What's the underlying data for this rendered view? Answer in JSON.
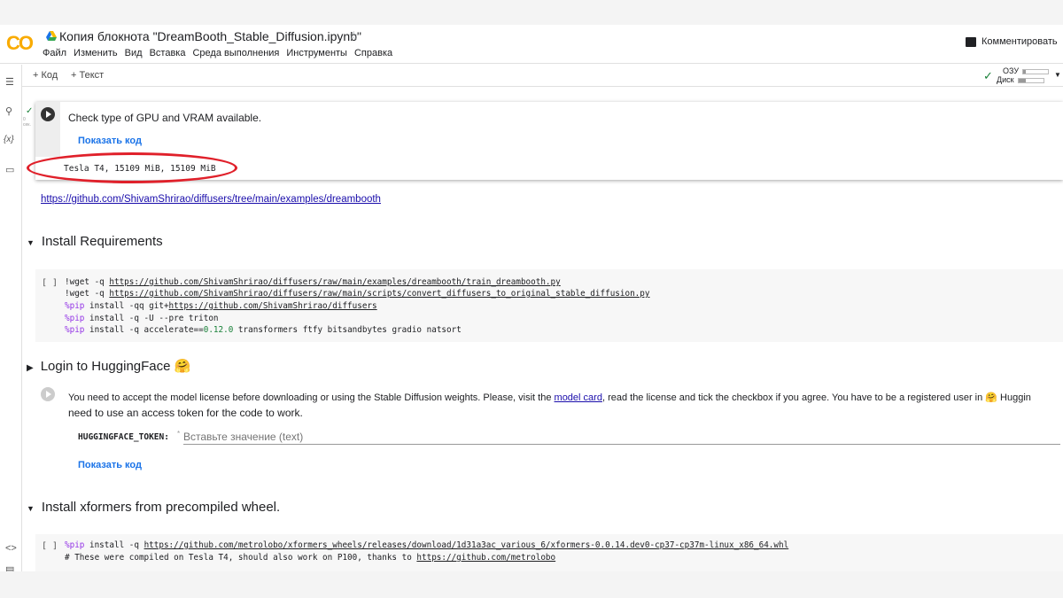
{
  "header": {
    "logo": "CO",
    "title": "Копия блокнота \"DreamBooth_Stable_Diffusion.ipynb\"",
    "menu": [
      "Файл",
      "Изменить",
      "Вид",
      "Вставка",
      "Среда выполнения",
      "Инструменты",
      "Справка"
    ],
    "comment": "Комментировать"
  },
  "toolbar": {
    "add_code": "+ Код",
    "add_text": "+ Текст",
    "ram": "ОЗУ",
    "disk": "Диск",
    "ram_fill": 0.1,
    "disk_fill": 0.3
  },
  "cell1": {
    "exec_time": "0 сек.",
    "title": "Check type of GPU and VRAM available.",
    "show_code": "Показать код",
    "output": "Tesla T4, 15109 MiB, 15109 MiB"
  },
  "link": "https://github.com/ShivamShrirao/diffusers/tree/main/examples/dreambooth",
  "sec1": {
    "title": "Install Requirements",
    "bracket": "[ ]",
    "lines": [
      [
        "!wget -q ",
        "https://github.com/ShivamShrirao/diffusers/raw/main/examples/dreambooth/train_dreambooth.py"
      ],
      [
        "!wget -q ",
        "https://github.com/ShivamShrirao/diffusers/raw/main/scripts/convert_diffusers_to_original_stable_diffusion.py"
      ],
      [
        "%pip",
        " install -qq git+",
        "https://github.com/ShivamShrirao/diffusers"
      ],
      [
        "%pip",
        " install -q -U --pre triton"
      ],
      [
        "%pip",
        " install -q accelerate==",
        "0.12.0",
        " transformers ftfy bitsandbytes gradio natsort"
      ]
    ]
  },
  "sec2": {
    "title": "Login to HuggingFace 🤗",
    "text1": "You need to accept the model license before downloading or using the Stable Diffusion weights. Please, visit the ",
    "model_card": "model card",
    "text2": ", read the license and tick the checkbox if you agree. You have to be a registered user in 🤗 Huggin",
    "text3": "need to use an access token for the code to work.",
    "field_label": "HUGGINGFACE_TOKEN:",
    "field_placeholder": "Вставьте значение (text)",
    "show_code": "Показать код"
  },
  "sec3": {
    "title": "Install xformers from precompiled wheel.",
    "bracket": "[ ]",
    "l1": [
      "%pip",
      " install -q ",
      "https://github.com/metrolobo/xformers_wheels/releases/download/1d31a3ac_various_6/xformers-0.0.14.dev0-cp37-cp37m-linux_x86_64.whl"
    ],
    "l2": [
      "# These were compiled on Tesla T4, should also work on P100, thanks to ",
      "https://github.com/metrolobo"
    ]
  }
}
